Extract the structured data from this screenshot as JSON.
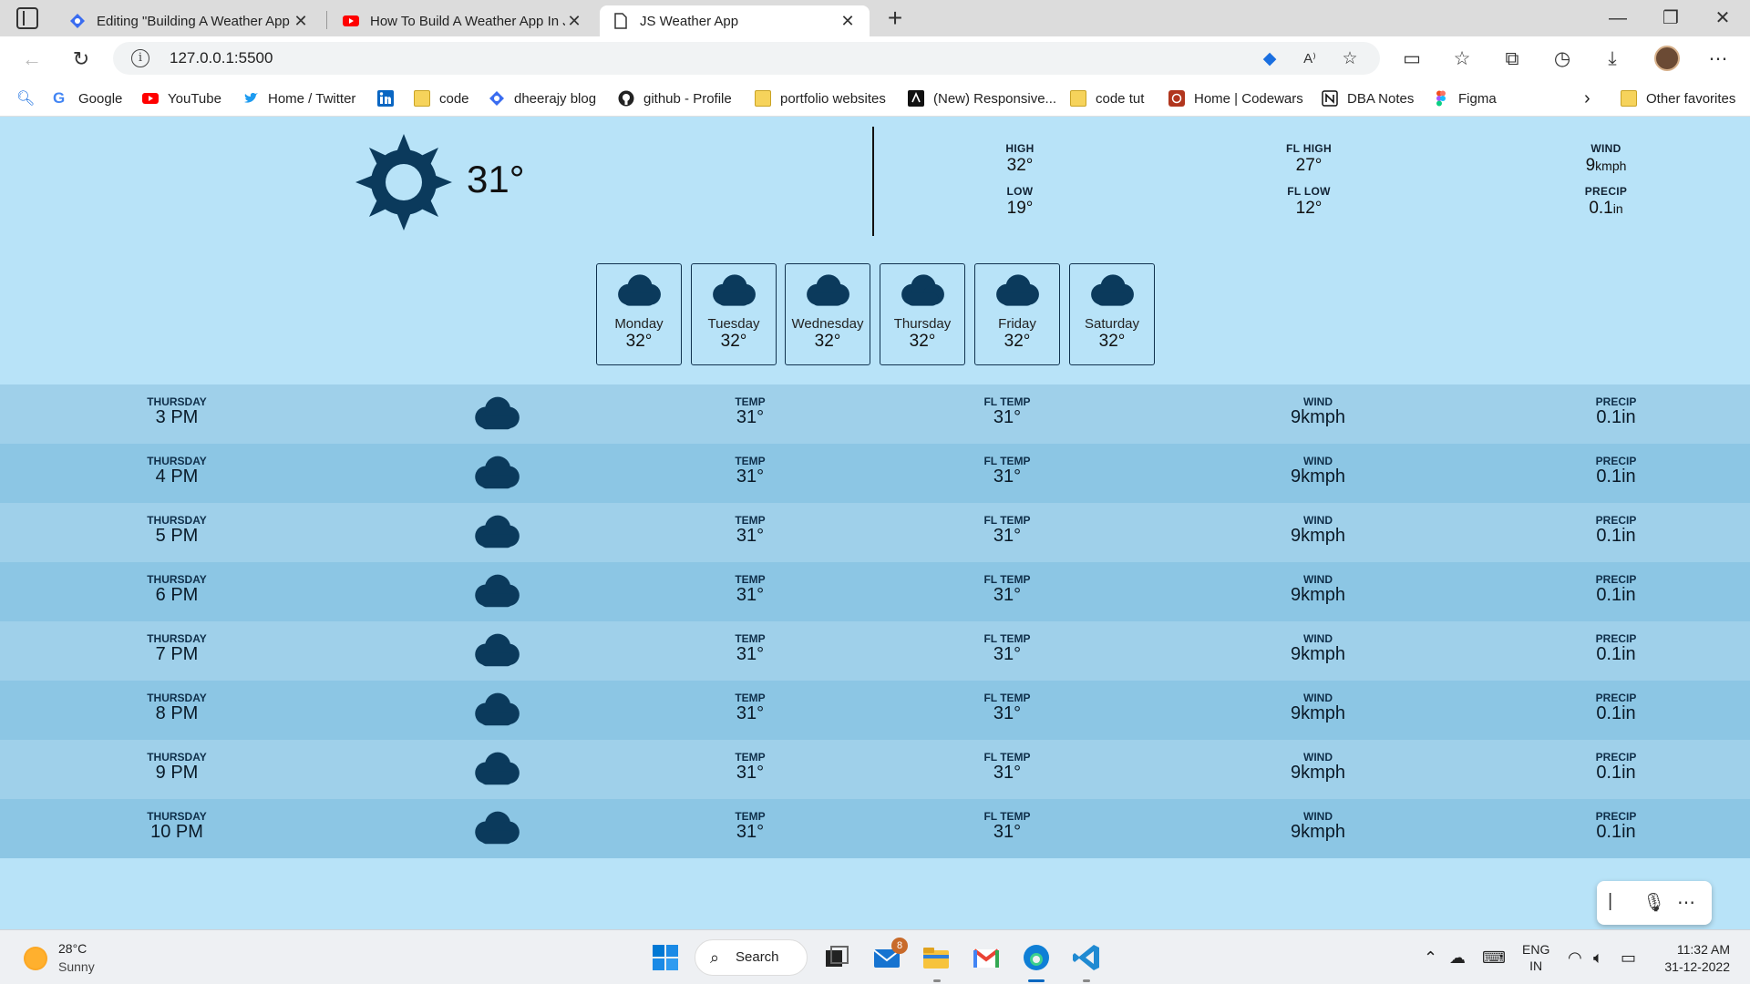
{
  "browser": {
    "tabs": [
      {
        "title": "Editing \"Building A Weather App",
        "icon": "site-icon",
        "active": false
      },
      {
        "title": "How To Build A Weather App In J",
        "icon": "youtube-icon",
        "active": false
      },
      {
        "title": "JS Weather App",
        "icon": "page-icon",
        "active": true
      }
    ],
    "url": "127.0.0.1:5500",
    "favorites": [
      {
        "label": "Google",
        "icon": "google-icon"
      },
      {
        "label": "YouTube",
        "icon": "youtube-icon"
      },
      {
        "label": "Home / Twitter",
        "icon": "twitter-icon"
      },
      {
        "label": "",
        "icon": "linkedin-icon"
      },
      {
        "label": "code",
        "icon": "folder-icon"
      },
      {
        "label": "dheerajy blog",
        "icon": "blog-icon"
      },
      {
        "label": "github - Profile",
        "icon": "github-icon"
      },
      {
        "label": "portfolio websites",
        "icon": "folder-icon"
      },
      {
        "label": "(New) Responsive...",
        "icon": "site-icon"
      },
      {
        "label": "code tut",
        "icon": "folder-icon"
      },
      {
        "label": "Home | Codewars",
        "icon": "codewars-icon"
      },
      {
        "label": "DBA Notes",
        "icon": "notion-icon"
      },
      {
        "label": "Figma",
        "icon": "figma-icon"
      }
    ],
    "other_favorites": "Other favorites"
  },
  "current": {
    "icon": "sun-icon",
    "temp": "31°",
    "stats": [
      {
        "label": "HIGH",
        "value": "32°"
      },
      {
        "label": "LOW",
        "value": "19°"
      },
      {
        "label": "FL HIGH",
        "value": "27°"
      },
      {
        "label": "FL LOW",
        "value": "12°"
      },
      {
        "label": "WIND",
        "value": "9",
        "unit": "kmph"
      },
      {
        "label": "PRECIP",
        "value": "0.1",
        "unit": "in"
      }
    ]
  },
  "daily": [
    {
      "day": "Monday",
      "temp": "32°",
      "icon": "cloud-icon"
    },
    {
      "day": "Tuesday",
      "temp": "32°",
      "icon": "cloud-icon"
    },
    {
      "day": "Wednesday",
      "temp": "32°",
      "icon": "cloud-icon"
    },
    {
      "day": "Thursday",
      "temp": "32°",
      "icon": "cloud-icon"
    },
    {
      "day": "Friday",
      "temp": "32°",
      "icon": "cloud-icon"
    },
    {
      "day": "Saturday",
      "temp": "32°",
      "icon": "cloud-icon"
    }
  ],
  "hourly_labels": {
    "temp": "TEMP",
    "fl_temp": "FL TEMP",
    "wind": "WIND",
    "precip": "PRECIP"
  },
  "hourly": [
    {
      "day": "THURSDAY",
      "time": "3 PM",
      "temp": "31°",
      "fl_temp": "31°",
      "wind": "9kmph",
      "precip": "0.1in"
    },
    {
      "day": "THURSDAY",
      "time": "4 PM",
      "temp": "31°",
      "fl_temp": "31°",
      "wind": "9kmph",
      "precip": "0.1in"
    },
    {
      "day": "THURSDAY",
      "time": "5 PM",
      "temp": "31°",
      "fl_temp": "31°",
      "wind": "9kmph",
      "precip": "0.1in"
    },
    {
      "day": "THURSDAY",
      "time": "6 PM",
      "temp": "31°",
      "fl_temp": "31°",
      "wind": "9kmph",
      "precip": "0.1in"
    },
    {
      "day": "THURSDAY",
      "time": "7 PM",
      "temp": "31°",
      "fl_temp": "31°",
      "wind": "9kmph",
      "precip": "0.1in"
    },
    {
      "day": "THURSDAY",
      "time": "8 PM",
      "temp": "31°",
      "fl_temp": "31°",
      "wind": "9kmph",
      "precip": "0.1in"
    },
    {
      "day": "THURSDAY",
      "time": "9 PM",
      "temp": "31°",
      "fl_temp": "31°",
      "wind": "9kmph",
      "precip": "0.1in"
    },
    {
      "day": "THURSDAY",
      "time": "10 PM",
      "temp": "31°",
      "fl_temp": "31°",
      "wind": "9kmph",
      "precip": "0.1in"
    }
  ],
  "taskbar": {
    "weather_temp": "28°C",
    "weather_cond": "Sunny",
    "search_label": "Search",
    "mail_badge": "8",
    "lang_1": "ENG",
    "lang_2": "IN",
    "time": "11:32 AM",
    "date": "31-12-2022"
  },
  "colors": {
    "app_bg": "#b8e3f8",
    "icon": "#0b3a5c",
    "row_a": "#9fd0ea",
    "row_b": "#8cc6e4"
  }
}
